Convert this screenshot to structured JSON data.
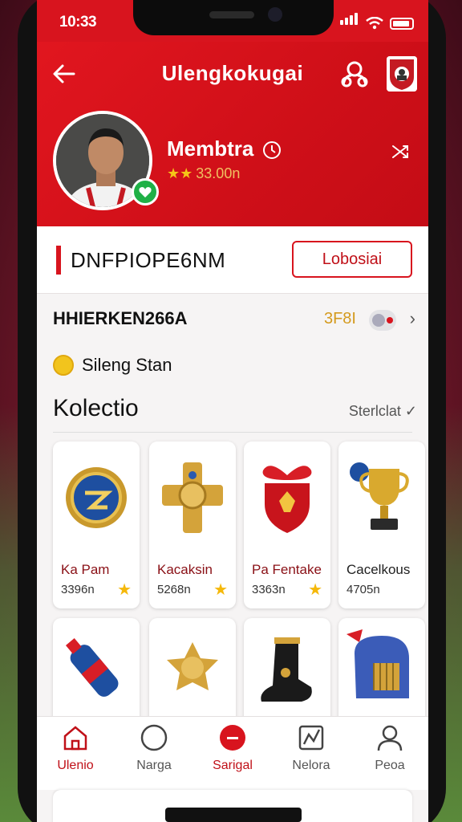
{
  "status": {
    "time": "10:33"
  },
  "header": {
    "title": "Ulengkokugai",
    "profile_name": "Membtra",
    "stars": "★★",
    "profile_value": "33.00n"
  },
  "banner": {
    "label": "DNFPIOPE6NM",
    "button_label": "Lobosiai"
  },
  "row_info": {
    "label": "HHIERKEN266A",
    "value": "3F8I"
  },
  "row_status": {
    "label": "Sileng Stan"
  },
  "collection": {
    "title": "Kolectio",
    "sort_label": "Sterlclat ✓",
    "items": [
      {
        "name": "Ka Pam",
        "price": "3396n",
        "icon": "badge-icon"
      },
      {
        "name": "Kacaksin",
        "price": "5268n",
        "icon": "cross-medal-icon"
      },
      {
        "name": "Pa Fentake",
        "price": "3363n",
        "icon": "ribbon-shield-icon"
      },
      {
        "name": "Cacelkous",
        "price": "4705n",
        "icon": "trophy-icon"
      }
    ],
    "second_row_icons": [
      "bottle-icon",
      "gold-medal-icon",
      "boot-icon",
      "helmet-icon"
    ]
  },
  "tabs": [
    {
      "label": "Ulenio",
      "icon": "home-icon",
      "active": true
    },
    {
      "label": "Narga",
      "icon": "circle-icon",
      "active": false
    },
    {
      "label": "Sarigal",
      "icon": "record-icon",
      "active": true
    },
    {
      "label": "Nelora",
      "icon": "chart-icon",
      "active": false
    },
    {
      "label": "Peoa",
      "icon": "user-icon",
      "active": false
    }
  ],
  "colors": {
    "brand_red": "#d8141e",
    "gold": "#f5b80a"
  }
}
